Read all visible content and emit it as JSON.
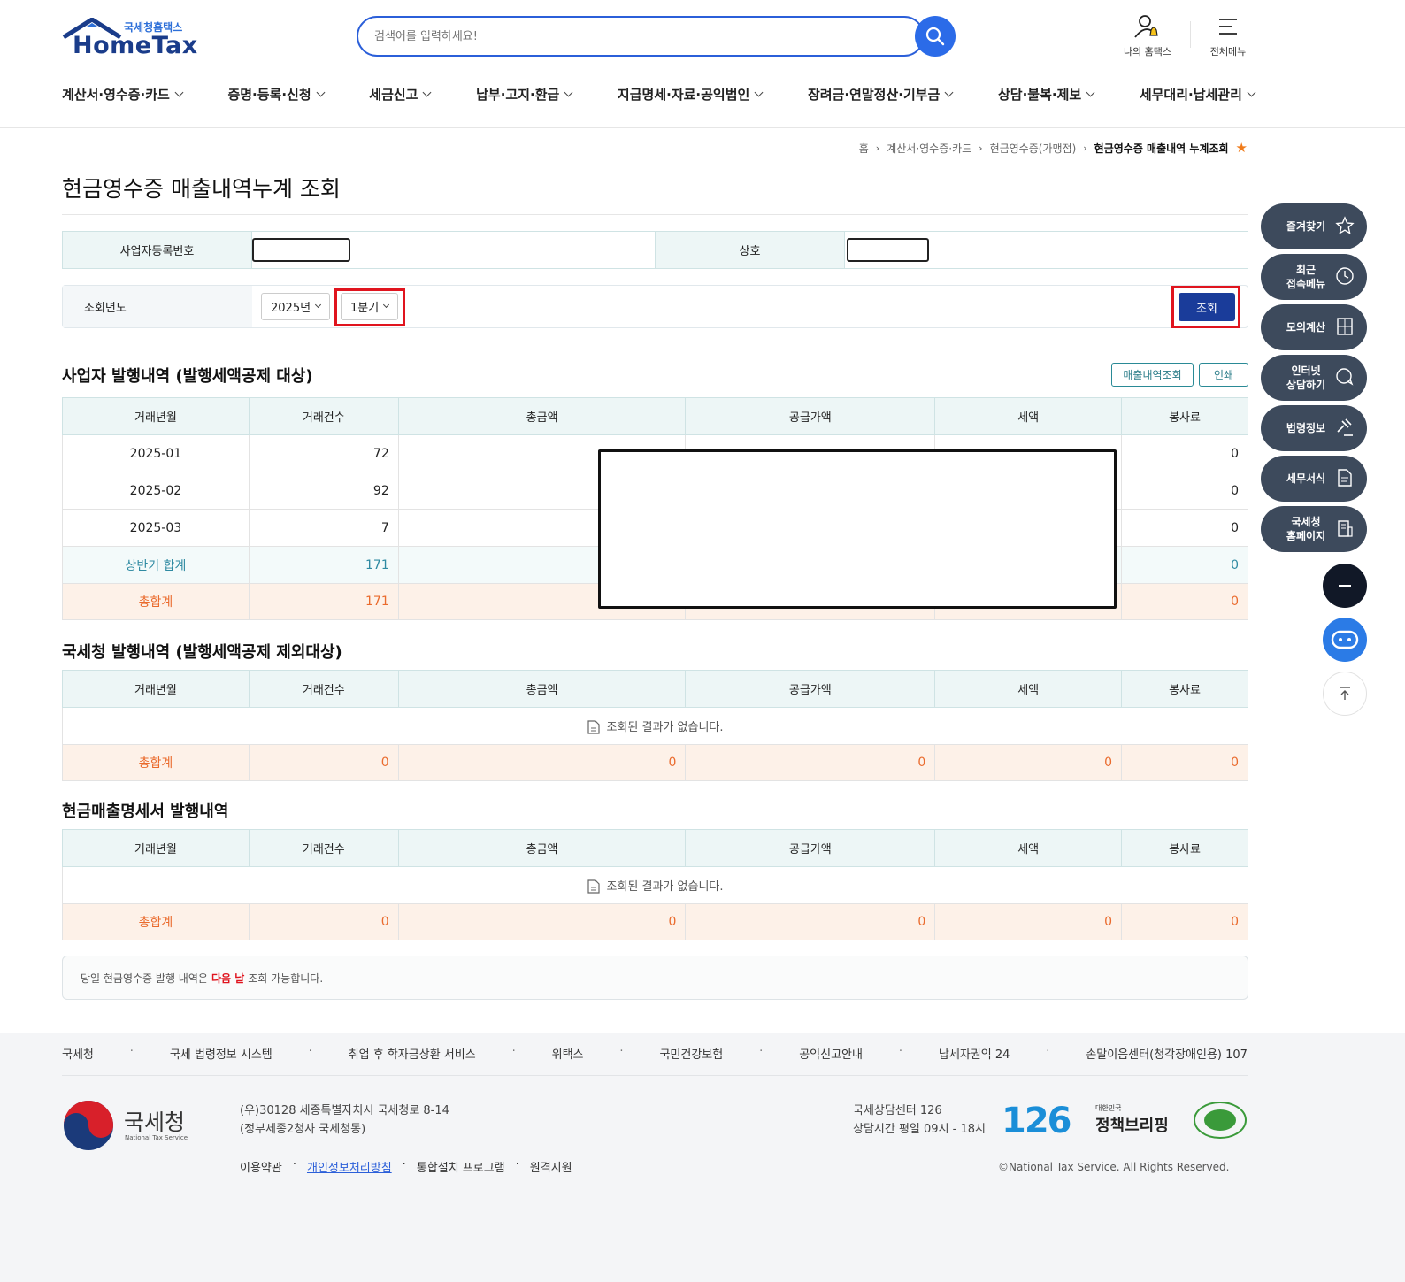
{
  "header": {
    "logo_sub": "국세청홈택스",
    "logo_main": "HomeTax",
    "search_placeholder": "검색어를 입력하세요!",
    "my_hometax": "나의 홈택스",
    "all_menu": "전체메뉴"
  },
  "gnb": [
    "계산서·영수증·카드",
    "증명·등록·신청",
    "세금신고",
    "납부·고지·환급",
    "지급명세·자료·공익법인",
    "장려금·연말정산·기부금",
    "상담·불복·제보",
    "세무대리·납세관리"
  ],
  "breadcrumb": [
    "홈",
    "계산서·영수증·카드",
    "현금영수증(가맹점)",
    "현금영수증 매출내역 누계조회"
  ],
  "page_title": "현금영수증 매출내역누계 조회",
  "form": {
    "biz_no_label": "사업자등록번호",
    "company_label": "상호",
    "year_label": "조회년도",
    "year_value": "2025년",
    "quarter_value": "1분기",
    "query_button": "조회"
  },
  "section1": {
    "title": "사업자 발행내역 (발행세액공제 대상)",
    "btn_sales": "매출내역조회",
    "btn_print": "인쇄",
    "headers": [
      "거래년월",
      "거래건수",
      "총금액",
      "공급가액",
      "세액",
      "봉사료"
    ],
    "rows": [
      {
        "month": "2025-01",
        "count": "72",
        "fee": "0"
      },
      {
        "month": "2025-02",
        "count": "92",
        "fee": "0"
      },
      {
        "month": "2025-03",
        "count": "7",
        "fee": "0"
      }
    ],
    "subtotal": {
      "label": "상반기 합계",
      "count": "171",
      "fee": "0"
    },
    "total": {
      "label": "총합계",
      "count": "171",
      "fee": "0"
    }
  },
  "section2": {
    "title": "국세청 발행내역 (발행세액공제 제외대상)",
    "headers": [
      "거래년월",
      "거래건수",
      "총금액",
      "공급가액",
      "세액",
      "봉사료"
    ],
    "empty": "조회된 결과가 없습니다.",
    "total": {
      "label": "총합계",
      "count": "0",
      "amount": "0",
      "supply": "0",
      "tax": "0",
      "fee": "0"
    }
  },
  "section3": {
    "title": "현금매출명세서 발행내역",
    "headers": [
      "거래년월",
      "거래건수",
      "총금액",
      "공급가액",
      "세액",
      "봉사료"
    ],
    "empty": "조회된 결과가 없습니다.",
    "total": {
      "label": "총합계",
      "count": "0",
      "amount": "0",
      "supply": "0",
      "tax": "0",
      "fee": "0"
    }
  },
  "notice": {
    "before": "당일 현금영수증 발행 내역은",
    "highlight": "다음 날",
    "after": "조회 가능합니다."
  },
  "quick_menu": [
    {
      "line1": "즐겨찾기",
      "line2": "",
      "icon": "star-icon"
    },
    {
      "line1": "최근",
      "line2": "접속메뉴",
      "icon": "clock-icon"
    },
    {
      "line1": "모의계산",
      "line2": "",
      "icon": "calculator-icon"
    },
    {
      "line1": "인터넷",
      "line2": "상담하기",
      "icon": "chat-icon"
    },
    {
      "line1": "법령정보",
      "line2": "",
      "icon": "gavel-icon"
    },
    {
      "line1": "세무서식",
      "line2": "",
      "icon": "form-icon"
    },
    {
      "line1": "국세청",
      "line2": "홈페이지",
      "icon": "building-icon"
    }
  ],
  "footer": {
    "links": [
      "국세청",
      "국세 법령정보 시스템",
      "취업 후 학자금상환 서비스",
      "위택스",
      "국민건강보험",
      "공익신고안내",
      "납세자권익 24",
      "손말이음센터(청각장애인용) 107"
    ],
    "org_name": "국세청",
    "org_en": "National Tax Service",
    "address1": "(우)30128 세종특별자치시 국세청로 8-14",
    "address2": "(정부세종2청사 국세청동)",
    "links2": [
      "이용약관",
      "개인정보처리방침",
      "통합설치 프로그램",
      "원격지원"
    ],
    "center": "국세상담센터 126",
    "hours": "상담시간 평일 09시 - 18시",
    "badge": "126",
    "briefing_small": "대한민국",
    "briefing": "정책브리핑",
    "copyright": "©National Tax Service. All Rights Reserved."
  },
  "colors": {
    "brand_blue": "#1a3c9a",
    "search_blue": "#2b6be8",
    "highlight_red": "#e0141e",
    "total_orange": "#ea6b2d",
    "subtotal_teal": "#2f8aa2"
  }
}
